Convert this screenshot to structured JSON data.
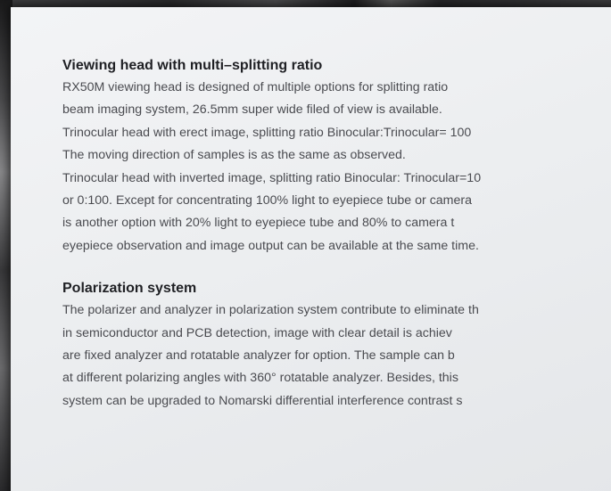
{
  "section_viewing": {
    "heading": "Viewing head with multi–splitting ratio",
    "lines": [
      "RX50M viewing head is designed of multiple options for splitting ratio",
      "beam imaging system, 26.5mm super wide filed of view is available.",
      "Trinocular head with erect image, splitting ratio Binocular:Trinocular= 100",
      "The moving direction of samples is as the same as observed.",
      "Trinocular head with inverted image, splitting ratio Binocular: Trinocular=10",
      "or 0:100. Except for concentrating 100% light to eyepiece tube or camera",
      "is another option with 20% light to eyepiece tube and 80% to camera t",
      "eyepiece observation and image output can be available at the same time."
    ]
  },
  "section_polarization": {
    "heading": "Polarization system",
    "lines": [
      "The polarizer and analyzer in polarization system contribute to eliminate th",
      "in semiconductor and PCB detection, image with clear detail is achiev",
      "are fixed analyzer and rotatable analyzer for option. The sample can b",
      "at different polarizing angles with 360° rotatable analyzer. Besides, this",
      "system can be upgraded to Nomarski differential interference contrast s"
    ]
  }
}
